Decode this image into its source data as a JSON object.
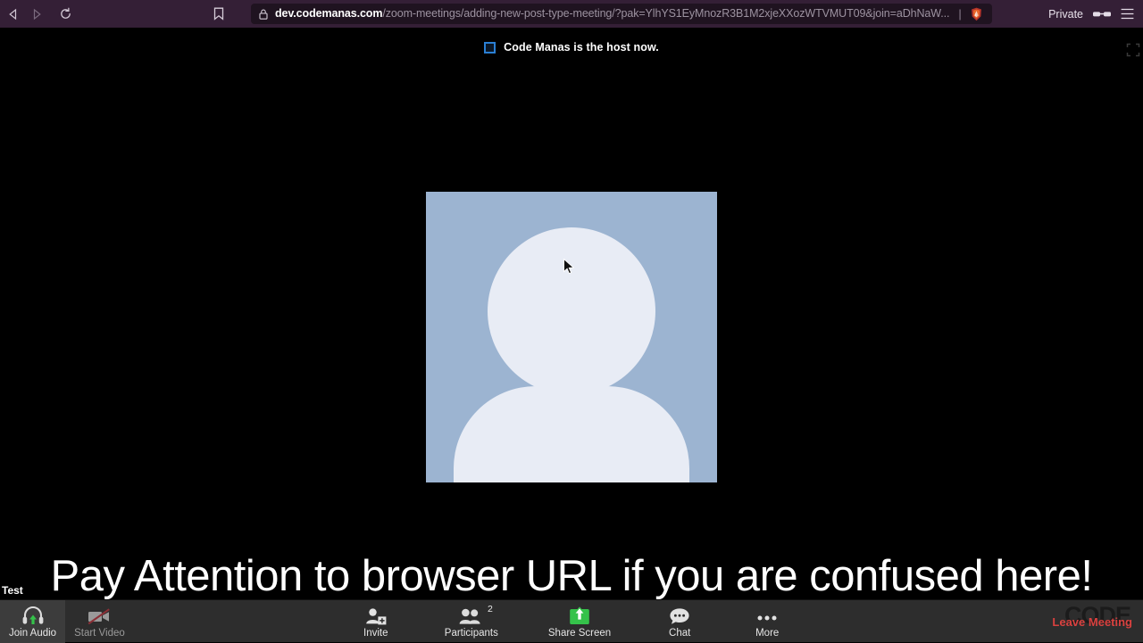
{
  "browser": {
    "name": "Brave",
    "mode_label": "Private",
    "icons": {
      "back": "back-arrow-icon",
      "forward": "forward-arrow-icon",
      "reload": "reload-icon",
      "bookmark": "bookmark-icon",
      "lock": "lock-icon",
      "brave": "brave-shield-icon",
      "private_glasses": "glasses-icon",
      "menu": "hamburger-menu-icon"
    },
    "url": {
      "domain": "dev.codemanas.com",
      "path": "/zoom-meetings/adding-new-post-type-meeting/?pak=YlhYS1EyMnozR3B1M2xjeXXozWTVMUT09&join=aDhNaW...",
      "full_display": "dev.codemanas.com/zoom-meetings/adding-new-post-type-meeting/?pak=YlhYS1EyMnozR3B1M2xjeXozWTVMUT09&join=aDhNaW...",
      "divider": "|"
    },
    "chrome_bg": "#341f36"
  },
  "meeting": {
    "banner": {
      "text": "Code Manas is the host now.",
      "icon": "blue-square-icon",
      "icon_color": "#2a7fd4"
    },
    "fullscreen_icon": "fullscreen-expand-icon",
    "tile": {
      "avatar_icon": "person-avatar-icon",
      "bg_color": "#9cb4d1",
      "silhouette_color": "#e8ecf5"
    },
    "caption": "Pay Attention to browser URL if you are confused here!",
    "test_label": "Test",
    "watermark": "CODE"
  },
  "toolbar": {
    "bg_color": "#2d2d2d",
    "left": [
      {
        "label": "Join Audio",
        "icon": "headset-join-audio-icon",
        "state": "active",
        "hover": true
      },
      {
        "label": "Start Video",
        "icon": "video-camera-off-icon",
        "state": "disabled",
        "hover": false
      }
    ],
    "center": [
      {
        "label": "Invite",
        "icon": "invite-person-add-icon",
        "badge": ""
      },
      {
        "label": "Participants",
        "icon": "participants-icon",
        "badge": "2"
      },
      {
        "label": "Share Screen",
        "icon": "share-screen-icon",
        "badge": ""
      },
      {
        "label": "Chat",
        "icon": "chat-bubble-icon",
        "badge": ""
      },
      {
        "label": "More",
        "icon": "more-dots-icon",
        "badge": ""
      }
    ],
    "leave_label": "Leave Meeting",
    "leave_color": "#d9413f",
    "share_screen_color": "#35c24a"
  }
}
